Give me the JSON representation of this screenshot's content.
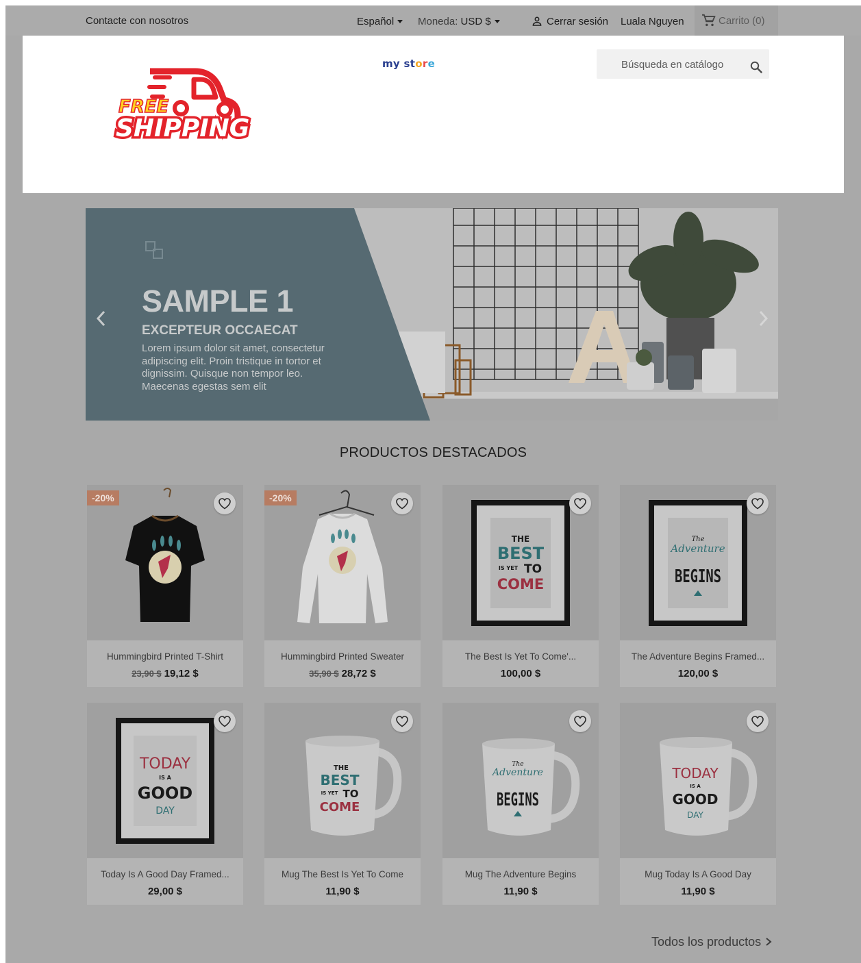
{
  "topnav": {
    "contact": "Contacte con nosotros",
    "language": "Español",
    "currency_label": "Moneda:",
    "currency_value": "USD $",
    "logout": "Cerrar sesión",
    "username": "Luala Nguyen",
    "cart": "Carrito (0)"
  },
  "header": {
    "logo": {
      "line1": "FREE",
      "line2": "SHIPPING",
      "colors": [
        "#e3232b",
        "#ffd21f"
      ]
    },
    "store_logo": {
      "part1": "my",
      "part2": "st",
      "part3": "o",
      "part4": "r",
      "part5": "e"
    },
    "search_placeholder": "Búsqueda en catálogo"
  },
  "hero": {
    "title": "SAMPLE 1",
    "subtitle": "EXCEPTEUR OCCAECAT",
    "text": "Lorem ipsum dolor sit amet, consectetur adipiscing elit. Proin tristique in tortor et dignissim. Quisque non tempor leo. Maecenas egestas sem elit",
    "panel_color": "#566a72",
    "prev_icon": "chevron-left-icon",
    "next_icon": "chevron-right-icon"
  },
  "featured": {
    "title": "PRODUCTOS DESTACADOS",
    "all_products": "Todos los productos",
    "products": [
      {
        "name": "Hummingbird Printed T-Shirt",
        "old_price": "23,90 $",
        "price": "19,12 $",
        "badge": "-20%",
        "image": "black-tshirt"
      },
      {
        "name": "Hummingbird Printed Sweater",
        "old_price": "35,90 $",
        "price": "28,72 $",
        "badge": "-20%",
        "image": "white-sweater"
      },
      {
        "name": "The Best Is Yet To Come'...",
        "price": "100,00 $",
        "image": "frame-best-is-yet"
      },
      {
        "name": "The Adventure Begins Framed...",
        "price": "120,00 $",
        "image": "frame-adventure"
      },
      {
        "name": "Today Is A Good Day Framed...",
        "price": "29,00 $",
        "image": "frame-good-day"
      },
      {
        "name": "Mug The Best Is Yet To Come",
        "price": "11,90 $",
        "image": "mug-best-is-yet"
      },
      {
        "name": "Mug The Adventure Begins",
        "price": "11,90 $",
        "image": "mug-adventure"
      },
      {
        "name": "Mug Today Is A Good Day",
        "price": "11,90 $",
        "image": "mug-good-day"
      }
    ],
    "art": {
      "best": {
        "the": "THE",
        "best": "BEST",
        "is_yet": "IS YET",
        "to": "TO",
        "come": "COME"
      },
      "adventure": {
        "the": "The",
        "adventure": "Adventure",
        "begins": "BEGINS"
      },
      "good_day": {
        "today": "TODAY",
        "is_a": "IS A",
        "good": "GOOD",
        "day": "DAY"
      }
    },
    "wishlist_icon": "heart-icon"
  }
}
